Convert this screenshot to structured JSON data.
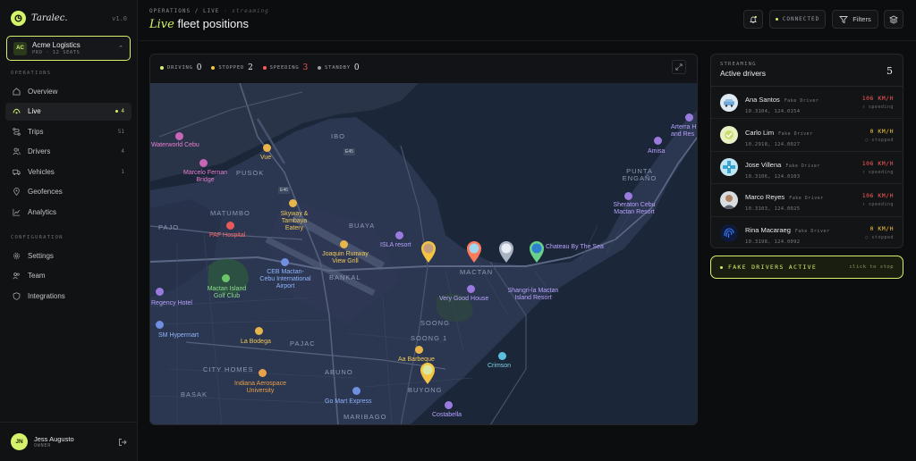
{
  "app": {
    "name": "Taralec.",
    "version": "v1.0"
  },
  "org": {
    "initials": "AC",
    "name": "Acme Logistics",
    "sub": "PRO · 12 SEATS"
  },
  "sidebar": {
    "operations_label": "OPERATIONS",
    "configuration_label": "CONFIGURATION",
    "items": [
      {
        "label": "Overview",
        "badge": "",
        "icon": "grid-icon"
      },
      {
        "label": "Live",
        "badge": "4",
        "icon": "pulse-icon"
      },
      {
        "label": "Trips",
        "badge": "51",
        "icon": "route-icon"
      },
      {
        "label": "Drivers",
        "badge": "4",
        "icon": "users-icon"
      },
      {
        "label": "Vehicles",
        "badge": "1",
        "icon": "truck-icon"
      },
      {
        "label": "Geofences",
        "badge": "",
        "icon": "pin-icon"
      },
      {
        "label": "Analytics",
        "badge": "",
        "icon": "chart-icon"
      }
    ],
    "config_items": [
      {
        "label": "Settings",
        "icon": "gear-icon"
      },
      {
        "label": "Team",
        "icon": "team-icon"
      },
      {
        "label": "Integrations",
        "icon": "shield-icon"
      }
    ]
  },
  "user": {
    "initials": "JN",
    "name": "Jess Augusto",
    "role": "OWNER"
  },
  "header": {
    "crumb_a": "OPERATIONS / LIVE",
    "crumb_b": "· streaming",
    "title_em": "Live",
    "title_rest": "fleet positions",
    "connected": "CONNECTED",
    "filters": "Filters"
  },
  "legend": [
    {
      "label": "DRIVING",
      "count": "0",
      "color": "#d4f36b"
    },
    {
      "label": "STOPPED",
      "count": "2",
      "color": "#f5c542"
    },
    {
      "label": "SPEEDING",
      "count": "3",
      "color": "#ff5b5b"
    },
    {
      "label": "STANDBY",
      "count": "0",
      "color": "#9a9da3"
    }
  ],
  "map": {
    "areas": [
      "IBO",
      "PUSOK",
      "MATUMBO",
      "PAJO",
      "BUAYA",
      "BANKAL",
      "MACTAN",
      "PUNTA ENGAÑO",
      "SOONG",
      "SOONG 1",
      "PAJAC",
      "ABUNO",
      "CITY HOMES",
      "BASAK",
      "BUYONG",
      "MARIBAGO"
    ],
    "pois": {
      "waterworld": "Waterworld Cebu",
      "marcelo": "Marcelo Fernan Bridge",
      "vue": "Vue",
      "skyway": "Skyway & Tambaya Eatery",
      "paf": "PAF Hospital",
      "joaquin": "Joaquin Runway View Grill",
      "isla": "ISLA resort",
      "chateau": "Chateau By The Sea",
      "sheraton": "Sheraton Cebu Mactan Resort",
      "amisa": "Amisa",
      "arterra": "Arterra H and Res",
      "ceb": "CEB Mactan-Cebu International Airport",
      "golf": "Mactan Island Golf Club",
      "regency": "Regency Hotel",
      "verygood": "Very Good House",
      "shangrila": "Shangri-la Mactan Island Resort",
      "sm": "SM Hypermart",
      "bodega": "La Bodega",
      "aabarbeque": "Aa Barbeque",
      "crimson": "Crimson",
      "indiana": "Indiana Aerospace University",
      "gomart": "Go Mart Express",
      "costabella": "Costabella"
    },
    "road_labels": [
      "E45",
      "E46"
    ]
  },
  "drivers": {
    "kicker": "STREAMING",
    "title": "Active drivers",
    "count": "5",
    "rows": [
      {
        "name": "Ana Santos",
        "tag": "Fake Driver",
        "coord": "10.3104, 124.0154",
        "speed": "106 KM/H",
        "status": "↑ speeding",
        "speed_color": "#ff5b5b",
        "avatar": "car"
      },
      {
        "name": "Carlo Lim",
        "tag": "Fake Driver",
        "coord": "10.2918, 124.0027",
        "speed": "0 KM/H",
        "status": "○ stopped",
        "speed_color": "#f5c542",
        "avatar": "lime"
      },
      {
        "name": "Jose Villena",
        "tag": "Fake Driver",
        "coord": "10.3106, 124.0103",
        "speed": "106 KM/H",
        "status": "↑ speeding",
        "speed_color": "#ff5b5b",
        "avatar": "pattern"
      },
      {
        "name": "Marco Reyes",
        "tag": "Fake Driver",
        "coord": "10.3103, 124.0025",
        "speed": "106 KM/H",
        "status": "↑ speeding",
        "speed_color": "#ff5b5b",
        "avatar": "person"
      },
      {
        "name": "Rina Macaraeg",
        "tag": "Fake Driver",
        "coord": "10.3198, 124.0092",
        "speed": "0 KM/H",
        "status": "○ stopped",
        "speed_color": "#f5c542",
        "avatar": "fingerprint"
      }
    ]
  },
  "fake": {
    "label": "FAKE DRIVERS ACTIVE",
    "action": "click to stop"
  },
  "colors": {
    "accent": "#d4f36b",
    "speeding": "#ff5b5b",
    "stopped": "#f5c542"
  }
}
